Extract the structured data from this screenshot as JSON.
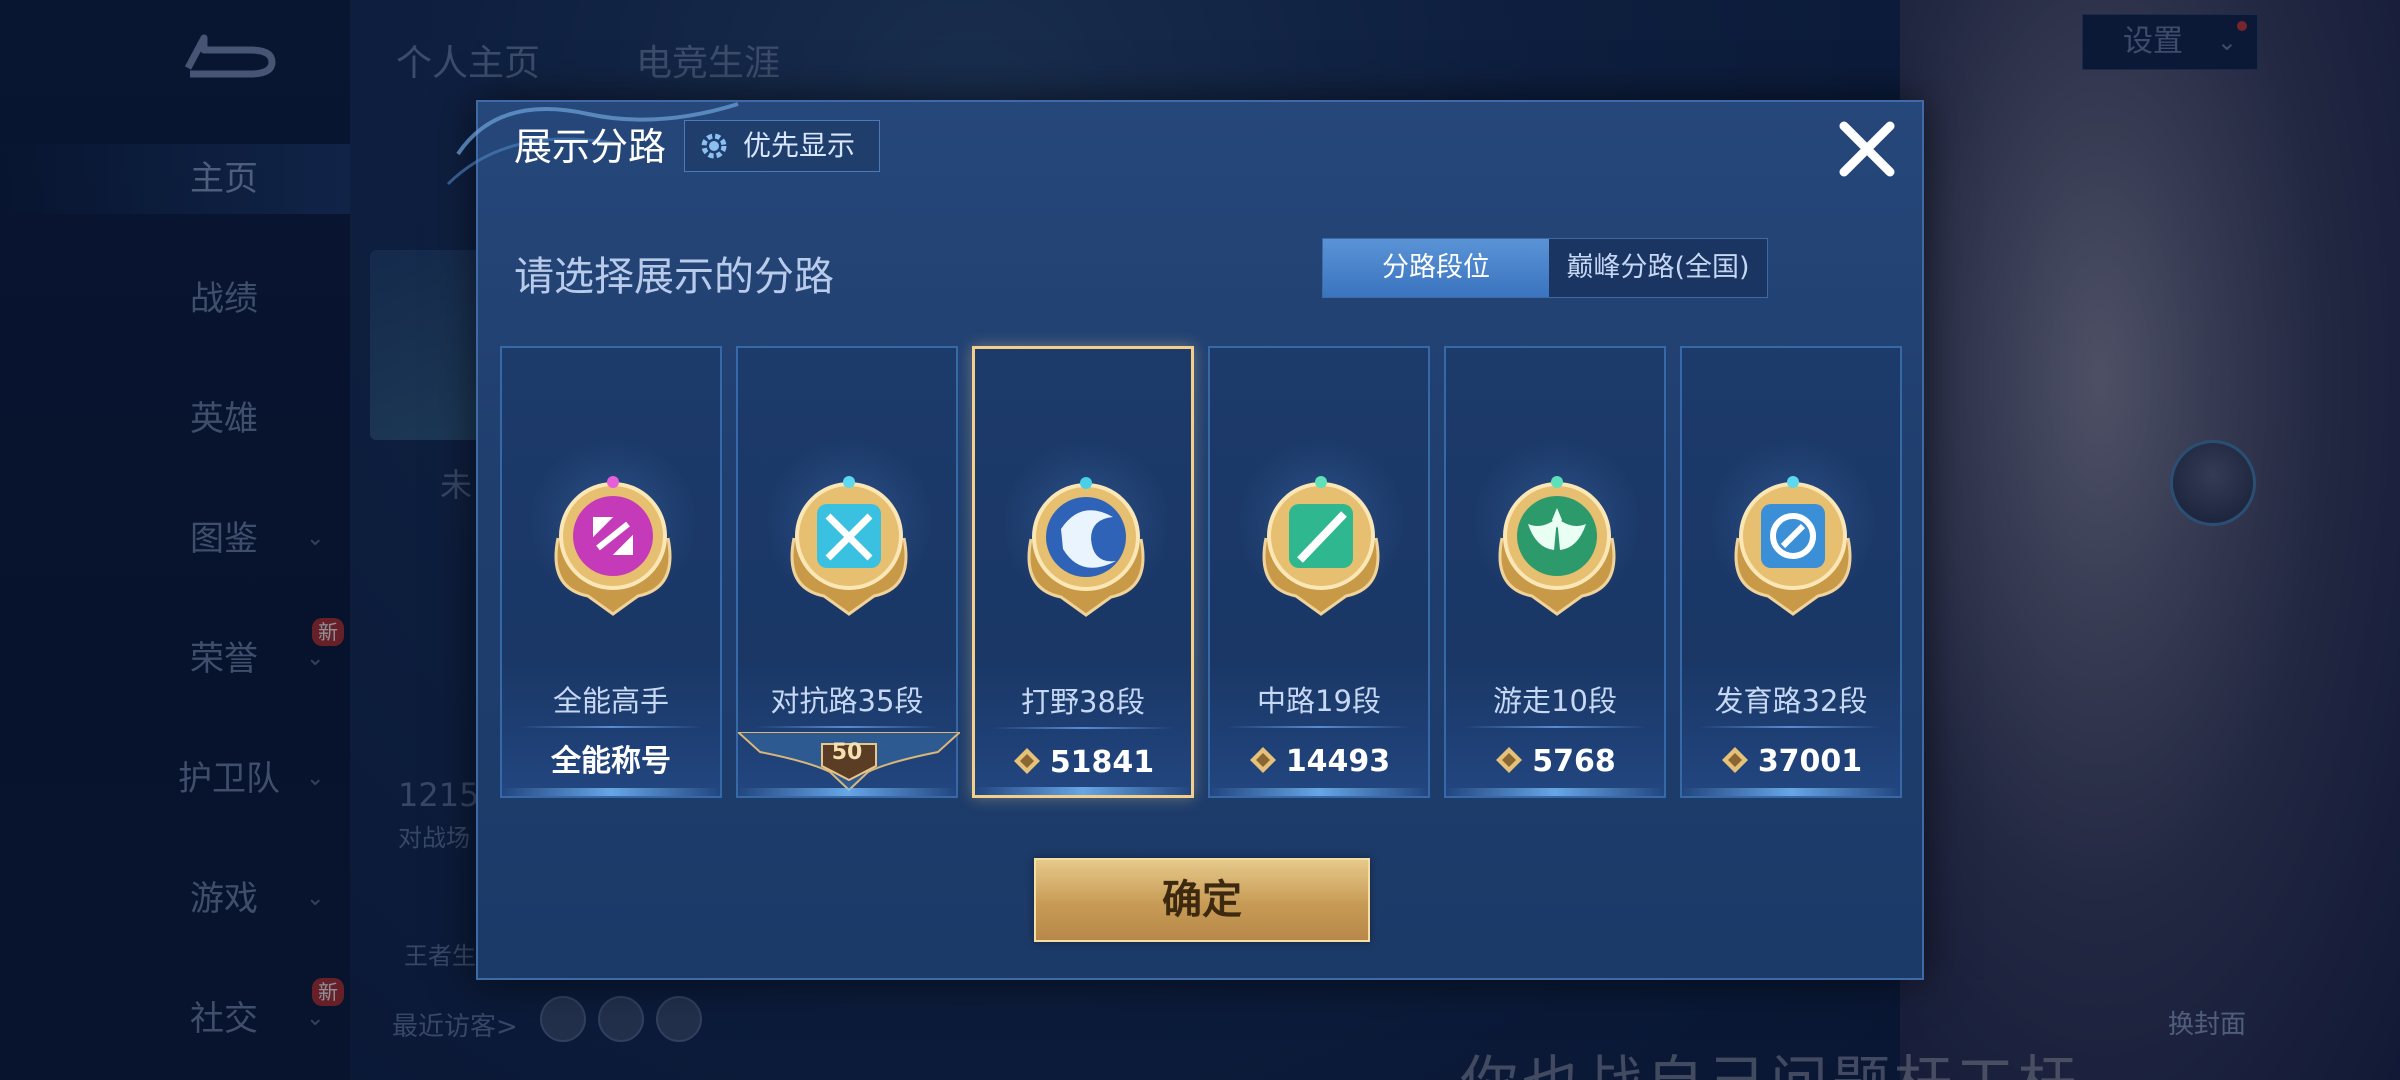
{
  "background": {
    "top_tabs": [
      "个人主页",
      "电竞生涯"
    ],
    "settings_label": "设置",
    "nav_items": [
      {
        "label": "主页",
        "active": true,
        "chevron": false,
        "new": false
      },
      {
        "label": "战绩",
        "active": false,
        "chevron": false,
        "new": false
      },
      {
        "label": "英雄",
        "active": false,
        "chevron": false,
        "new": false
      },
      {
        "label": "图鉴",
        "active": false,
        "chevron": true,
        "new": false
      },
      {
        "label": "荣誉",
        "active": false,
        "chevron": true,
        "new": true
      },
      {
        "label": "护卫队",
        "active": false,
        "chevron": true,
        "new": false
      },
      {
        "label": "游戏",
        "active": false,
        "chevron": true,
        "new": false
      },
      {
        "label": "社交",
        "active": false,
        "chevron": true,
        "new": true
      }
    ],
    "new_badge": "新",
    "frag_unlit": "未",
    "frag_count": "1215",
    "frag_count_label": "对战场",
    "frag_king": "王者生",
    "recent_visitors": "最近访客>",
    "change_cover": "换封面",
    "bottom_caption": "你也战自己问题杆工杆"
  },
  "modal": {
    "title": "展示分路",
    "priority_button": "优先显示",
    "subtitle": "请选择展示的分路",
    "tabs": [
      {
        "label": "分路段位",
        "active": true
      },
      {
        "label": "巅峰分路(全国)",
        "active": false
      }
    ],
    "cards": [
      {
        "name": "全能高手",
        "value": "全能称号",
        "type": "title",
        "color": "#c43ab8",
        "selected": false
      },
      {
        "name": "对抗路35段",
        "value": "50",
        "type": "plate",
        "color": "#3ac0e0",
        "selected": false
      },
      {
        "name": "打野38段",
        "value": "51841",
        "type": "points",
        "color": "#2f63b8",
        "selected": true
      },
      {
        "name": "中路19段",
        "value": "14493",
        "type": "points",
        "color": "#2fb88f",
        "selected": false
      },
      {
        "name": "游走10段",
        "value": "5768",
        "type": "points",
        "color": "#2d9a6c",
        "selected": false
      },
      {
        "name": "发育路32段",
        "value": "37001",
        "type": "points",
        "color": "#3a8fd6",
        "selected": false
      }
    ],
    "confirm_button": "确定"
  }
}
